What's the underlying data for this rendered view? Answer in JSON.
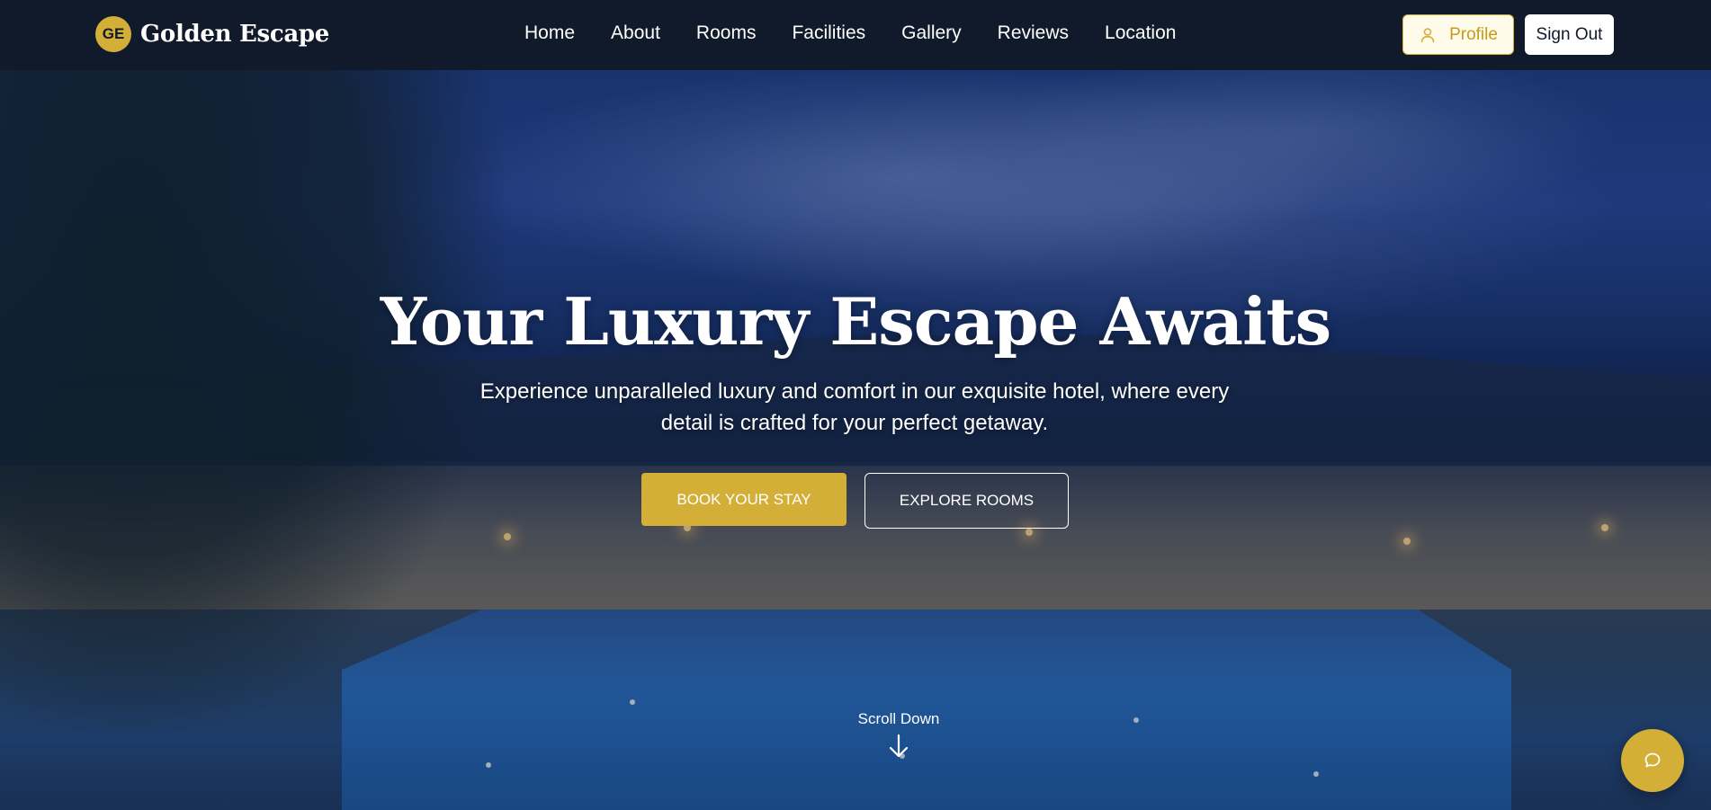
{
  "brand": {
    "logo_initials": "GE",
    "name": "Golden Escape"
  },
  "nav": {
    "links": [
      "Home",
      "About",
      "Rooms",
      "Facilities",
      "Gallery",
      "Reviews",
      "Location"
    ]
  },
  "account": {
    "profile_label": "Profile",
    "signout_label": "Sign Out"
  },
  "hero": {
    "title": "Your Luxury Escape Awaits",
    "subtitle": "Experience unparalleled luxury and comfort in our exquisite hotel, where every detail is crafted for your perfect getaway.",
    "primary_cta": "BOOK YOUR STAY",
    "secondary_cta": "EXPLORE ROOMS",
    "scroll_label": "Scroll Down"
  },
  "icons": {
    "profile": "user-icon",
    "scroll": "arrow-down-icon",
    "chat": "chat-bubble-icon"
  },
  "colors": {
    "accent": "#d4af37",
    "nav_bg": "#111a2a",
    "text_light": "#ffffff"
  }
}
